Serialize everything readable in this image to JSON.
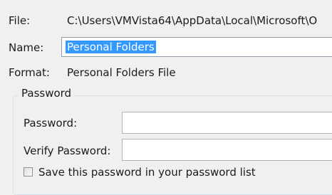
{
  "file": {
    "label": "File:",
    "value": "C:\\Users\\VMVista64\\AppData\\Local\\Microsoft\\O"
  },
  "name": {
    "label": "Name:",
    "value": "Personal Folders"
  },
  "format": {
    "label": "Format:",
    "value": "Personal Folders File"
  },
  "password_group": {
    "title": "Password",
    "password_label": "Password:",
    "verify_label": "Verify Password:",
    "password_value": "",
    "verify_value": "",
    "save_checkbox_label": "Save this password in your password list",
    "save_checked": false
  },
  "colors": {
    "background": "#f0f0f0",
    "selection": "#3399ff",
    "input_border": "#8e9aa8"
  }
}
